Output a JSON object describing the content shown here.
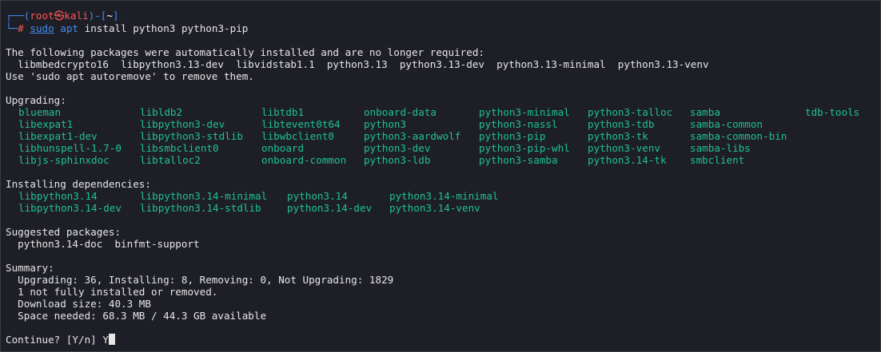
{
  "prompt": {
    "frame_top_left": "┌──(",
    "user": "root",
    "at_symbol": "㉿",
    "host": "kali",
    "frame_mid": ")-[",
    "path": "~",
    "frame_end": "]",
    "frame_bottom": "└─",
    "hash": "#",
    "cmd_sudo": "sudo",
    "cmd_apt": "apt",
    "cmd_rest": "install python3 python3-pip"
  },
  "auto_installed": {
    "header": "The following packages were automatically installed and are no longer required:",
    "packages_line": "  libmbedcrypto16  libpython3.13-dev  libvidstab1.1  python3.13  python3.13-dev  python3.13-minimal  python3.13-venv",
    "hint": "Use 'sudo apt autoremove' to remove them."
  },
  "upgrading": {
    "header": "Upgrading:",
    "rows": [
      [
        "blueman",
        "libldb2",
        "libtdb1",
        "onboard-data",
        "python3-minimal",
        "python3-talloc",
        "samba",
        "tdb-tools"
      ],
      [
        "libexpat1",
        "libpython3-dev",
        "libtevent0t64",
        "python3",
        "python3-nassl",
        "python3-tdb",
        "samba-common",
        ""
      ],
      [
        "libexpat1-dev",
        "libpython3-stdlib",
        "libwbclient0",
        "python3-aardwolf",
        "python3-pip",
        "python3-tk",
        "samba-common-bin",
        ""
      ],
      [
        "libhunspell-1.7-0",
        "libsmbclient0",
        "onboard",
        "python3-dev",
        "python3-pip-whl",
        "python3-venv",
        "samba-libs",
        ""
      ],
      [
        "libjs-sphinxdoc",
        "libtalloc2",
        "onboard-common",
        "python3-ldb",
        "python3-samba",
        "python3.14-tk",
        "smbclient",
        ""
      ]
    ]
  },
  "deps": {
    "header": "Installing dependencies:",
    "rows": [
      [
        "libpython3.14",
        "libpython3.14-minimal",
        "python3.14",
        "python3.14-minimal"
      ],
      [
        "libpython3.14-dev",
        "libpython3.14-stdlib",
        "python3.14-dev",
        "python3.14-venv"
      ]
    ]
  },
  "suggested": {
    "header": "Suggested packages:",
    "packages_line": "  python3.14-doc  binfmt-support"
  },
  "summary": {
    "header": "Summary:",
    "lines": [
      "  Upgrading: 36, Installing: 8, Removing: 0, Not Upgrading: 1829",
      "  1 not fully installed or removed.",
      "  Download size: 40.3 MB",
      "  Space needed: 68.3 MB / 44.3 GB available"
    ]
  },
  "continue_prompt": "Continue? [Y/n] ",
  "user_answer": "Y",
  "colors": {
    "background": "#1e1f26",
    "text": "#e6e6e6",
    "package_green": "#1fc095",
    "prompt_blue": "#3f8cf0",
    "prompt_red": "#ff5555"
  }
}
